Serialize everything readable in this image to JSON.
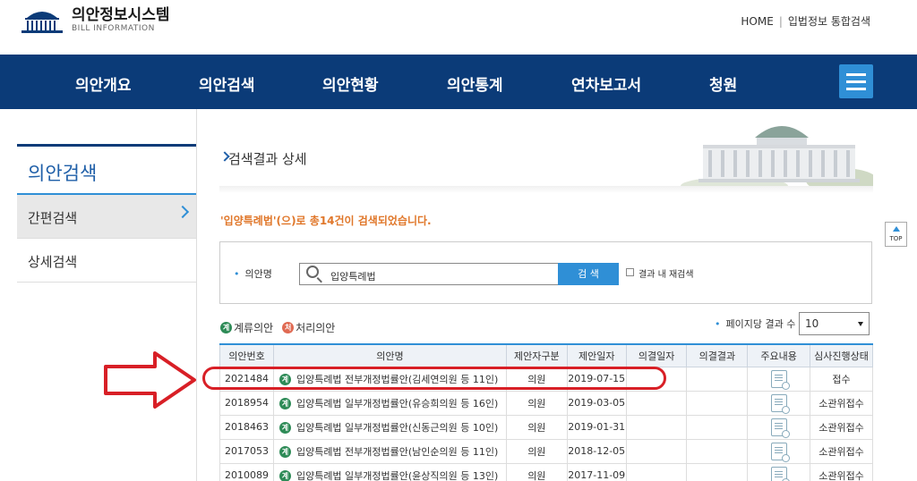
{
  "header": {
    "logo_title": "의안정보시스템",
    "logo_sub": "BILL INFORMATION",
    "util_links": [
      "HOME",
      "입법정보 통합검색"
    ],
    "util_sep": "|"
  },
  "gnb": {
    "items": [
      "의안개요",
      "의안검색",
      "의안현황",
      "의안통계",
      "연차보고서",
      "청원"
    ],
    "menu_icon": "hamburger-icon"
  },
  "sidebar": {
    "title": "의안검색",
    "items": [
      {
        "label": "간편검색",
        "active": true
      },
      {
        "label": "상세검색",
        "active": false
      }
    ]
  },
  "content": {
    "title": "검색결과 상세",
    "result_message": "'입양특례법'(으)로 총14건이 검색되었습니다."
  },
  "search": {
    "label": "의안명",
    "value": "입양특례법",
    "button": "검 색",
    "within_label": "결과 내 재검색"
  },
  "legend": {
    "pending_badge": "계",
    "pending_label": "계류의안",
    "processed_badge": "처",
    "processed_label": "처리의안"
  },
  "perpage": {
    "label": "페이지당 결과 수",
    "selected": "10"
  },
  "top_button": "TOP",
  "table": {
    "headers": [
      "의안번호",
      "의안명",
      "제안자구분",
      "제안일자",
      "의결일자",
      "의결결과",
      "주요내용",
      "심사진행상태"
    ],
    "rows": [
      {
        "no": "2021484",
        "badge": "계",
        "name": "입양특례법 전부개정법률안(김세연의원 등 11인)",
        "proposer": "의원",
        "date": "2019-07-15",
        "decided": "",
        "result": "",
        "status": "접수"
      },
      {
        "no": "2018954",
        "badge": "계",
        "name": "입양특례법 일부개정법률안(유승희의원 등 16인)",
        "proposer": "의원",
        "date": "2019-03-05",
        "decided": "",
        "result": "",
        "status": "소관위접수"
      },
      {
        "no": "2018463",
        "badge": "계",
        "name": "입양특례법 일부개정법률안(신동근의원 등 10인)",
        "proposer": "의원",
        "date": "2019-01-31",
        "decided": "",
        "result": "",
        "status": "소관위접수"
      },
      {
        "no": "2017053",
        "badge": "계",
        "name": "입양특례법 전부개정법률안(남인순의원 등 11인)",
        "proposer": "의원",
        "date": "2018-12-05",
        "decided": "",
        "result": "",
        "status": "소관위접수"
      },
      {
        "no": "2010089",
        "badge": "계",
        "name": "입양특례법 일부개정법률안(윤상직의원 등 13인)",
        "proposer": "의원",
        "date": "2017-11-09",
        "decided": "",
        "result": "",
        "status": "소관위접수"
      }
    ]
  },
  "colors": {
    "navy": "#0b3b78",
    "blue": "#2f8fd6",
    "orange": "#e0772a",
    "annotation_red": "#d81f26"
  }
}
